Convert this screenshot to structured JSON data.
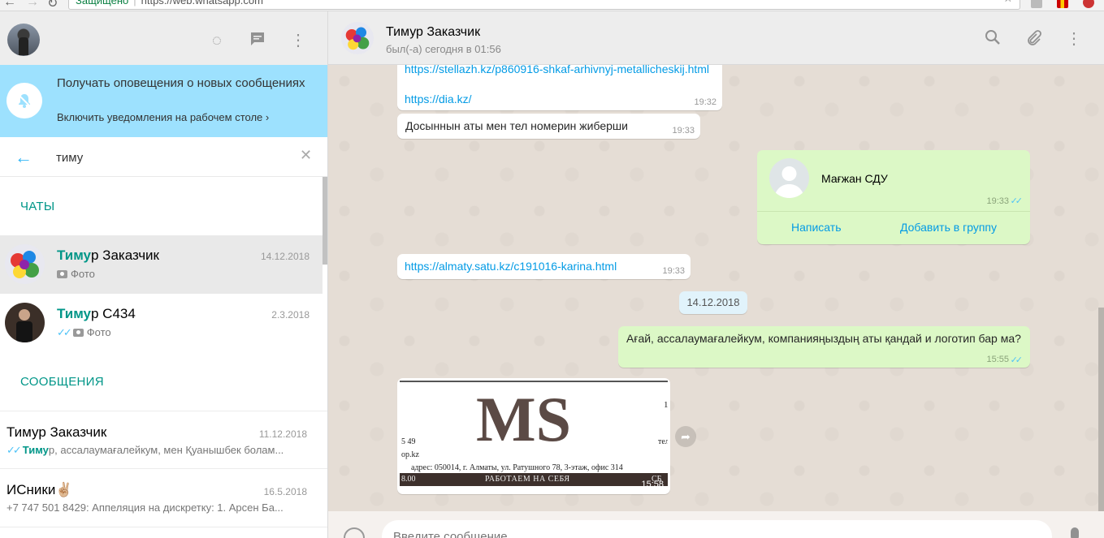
{
  "browser": {
    "secure_label": "Защищено",
    "url": "https://web.whatsapp.com"
  },
  "sidebar": {
    "notification": {
      "title": "Получать оповещения о новых сообщениях",
      "link": "Включить уведомления на рабочем столе ›"
    },
    "search": {
      "query": "тиму"
    },
    "chats_section_title": "ЧАТЫ",
    "chats": [
      {
        "name_highlight": "Тиму",
        "name_rest": "р Заказчик",
        "date": "14.12.2018",
        "last": "Фото",
        "active": true
      },
      {
        "name_highlight": "Тиму",
        "name_rest": "р С434",
        "date": "2.3.2018",
        "last": "Фото",
        "ticks": "✓✓",
        "active": false
      }
    ],
    "messages_section_title": "СООБЩЕНИЯ",
    "messages": [
      {
        "name": "Тимур Заказчик",
        "date": "11.12.2018",
        "ticks": "✓✓",
        "highlight": "Тиму",
        "preview": "р, ассалаумағалейкум, мен Қуанышбек болам..."
      },
      {
        "name": "ИСники✌🏼",
        "date": "16.5.2018",
        "highlight": "",
        "preview": "+7 747 501 8429: Аппеляция на дискретку: 1. Арсен Ба..."
      }
    ]
  },
  "conversation": {
    "name": "Тимур Заказчик",
    "status": "был(-а) сегодня в 01:56",
    "messages": {
      "link1": "https://stellazh.kz/p860916-shkaf-arhivnyj-metallicheskij.html",
      "link2": "https://dia.kz/",
      "time1": "19:32",
      "text2": "Досыннын аты мен тел номерин жиберши",
      "time2": "19:33",
      "contact_name": "Мағжан СДУ",
      "contact_time": "19:33",
      "contact_ticks": "✓✓",
      "contact_action_write": "Написать",
      "contact_action_add": "Добавить в группу",
      "link3": "https://almaty.satu.kz/c191016-karina.html",
      "time3": "19:33",
      "date_chip": "14.12.2018",
      "out_text": "Ағай, ассалаумағалейкум, компанияңыздың аты қандай и логотип бар ма?",
      "out_time": "15:55",
      "out_ticks": "✓✓",
      "image_logo": "MS",
      "image_line_phone": "5 49",
      "image_line_site": "op.kz",
      "image_line_right": "тел",
      "image_line_right2": "1",
      "image_address": "адрес: 050014, г. Алматы, ул. Ратушного 78, 3-этаж, офис 314",
      "image_band_left": "8.00",
      "image_band": "РАБОТАЕМ НА СЕБЯ",
      "image_band_right": "СБ",
      "image_time": "15:58"
    },
    "composer_placeholder": "Введите сообщение"
  }
}
